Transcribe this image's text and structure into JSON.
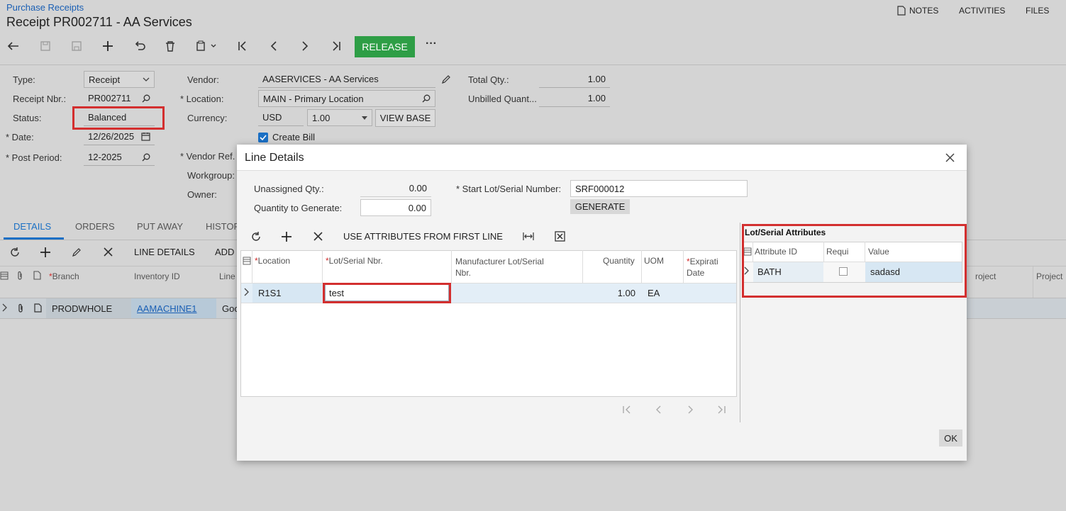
{
  "header": {
    "breadcrumb": "Purchase Receipts",
    "title": "Receipt PR002711 - AA Services",
    "notes": "NOTES",
    "activities": "ACTIVITIES",
    "files": "FILES"
  },
  "toolbar": {
    "release": "RELEASE",
    "more": "···"
  },
  "form": {
    "type_label": "Type:",
    "type_value": "Receipt",
    "receipt_nbr_label": "Receipt Nbr.:",
    "receipt_nbr_value": "PR002711",
    "status_label": "Status:",
    "status_value": "Balanced",
    "date_label": "Date:",
    "date_value": "12/26/2025",
    "post_period_label": "Post Period:",
    "post_period_value": "12-2025",
    "vendor_label": "Vendor:",
    "vendor_value": "AASERVICES - AA Services",
    "location_label": "Location:",
    "location_value": "MAIN - Primary Location",
    "currency_label": "Currency:",
    "currency_value": "USD",
    "rate_value": "1.00",
    "view_base": "VIEW BASE",
    "create_bill": "Create Bill",
    "vendor_ref_label": "Vendor Ref.",
    "workgroup_label": "Workgroup:",
    "owner_label": "Owner:",
    "total_qty_label": "Total Qty.:",
    "total_qty_value": "1.00",
    "unbilled_label": "Unbilled Quant...",
    "unbilled_value": "1.00"
  },
  "tabs": [
    "DETAILS",
    "ORDERS",
    "PUT AWAY",
    "HISTOR"
  ],
  "details_toolbar": {
    "line_details": "LINE DETAILS",
    "add": "ADD"
  },
  "grid": {
    "headers": {
      "branch": "Branch",
      "inventory_id": "Inventory ID",
      "line": "Line",
      "project": "roject",
      "project2": "Project"
    },
    "row": {
      "branch": "PRODWHOLE",
      "inventory_id": "AAMACHINE1",
      "line": "Goo"
    }
  },
  "dialog": {
    "title": "Line Details",
    "unassigned_label": "Unassigned Qty.:",
    "unassigned_value": "0.00",
    "qty_generate_label": "Quantity to Generate:",
    "qty_generate_value": "0.00",
    "start_lot_label": "Start Lot/Serial Number:",
    "start_lot_value": "SRF000012",
    "generate": "GENERATE",
    "use_attributes": "USE ATTRIBUTES FROM FIRST LINE",
    "headers": {
      "location": "Location",
      "lot_serial": "Lot/Serial Nbr.",
      "manufacturer": "Manufacturer Lot/Serial Nbr.",
      "quantity": "Quantity",
      "uom": "UOM",
      "expiration": "Expirati Date"
    },
    "row": {
      "location": "R1S1",
      "lot_serial": "test",
      "manufacturer": "",
      "quantity": "1.00",
      "uom": "EA"
    },
    "attributes": {
      "title": "Lot/Serial Attributes",
      "attribute_id": "Attribute ID",
      "required": "Requi",
      "value": "Value",
      "row_id": "BATH",
      "row_value": "sadasd"
    },
    "ok": "OK"
  },
  "colors": {
    "release_green": "#2e9e46",
    "highlight_red": "#d32f2f",
    "link_blue": "#1a5fb4",
    "row_select": "#d7e7f3"
  }
}
